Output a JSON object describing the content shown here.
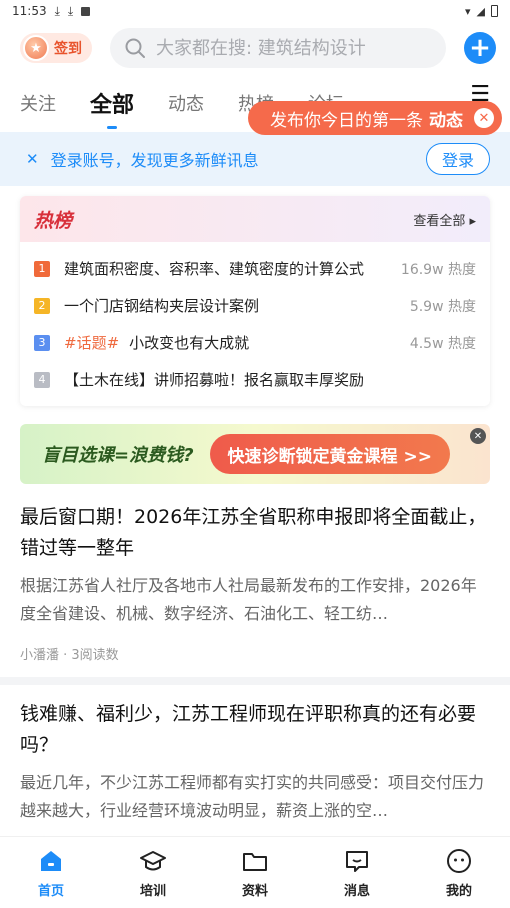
{
  "status": {
    "time": "11:53",
    "icons_left": [
      "download-icon",
      "download-icon",
      "app-icon"
    ],
    "icons_right": [
      "wifi-icon",
      "signal-icon",
      "battery-icon"
    ]
  },
  "header": {
    "checkin_label": "签到",
    "search_placeholder": "大家都在搜: 建筑结构设计"
  },
  "tabs": [
    {
      "label": "关注"
    },
    {
      "label": "全部"
    },
    {
      "label": "动态"
    },
    {
      "label": "热榜"
    },
    {
      "label": "论坛"
    }
  ],
  "bubble": {
    "text": "发布你今日的第一条",
    "emph": "动态"
  },
  "login": {
    "message": "登录账号，发现更多新鲜讯息",
    "button": "登录"
  },
  "hot": {
    "title": "热榜",
    "more": "查看全部 ▸",
    "items": [
      {
        "rank": "1",
        "text": "建筑面积密度、容积率、建筑密度的计算公式",
        "tag": "",
        "heat": "16.9w 热度",
        "color": "#f06a3a"
      },
      {
        "rank": "2",
        "text": "一个门店钢结构夹层设计案例",
        "tag": "",
        "heat": "5.9w 热度",
        "color": "#f5b526"
      },
      {
        "rank": "3",
        "text": "小改变也有大成就",
        "tag": "#话题#",
        "heat": "4.5w 热度",
        "color": "#5b8ff0"
      },
      {
        "rank": "4",
        "text": "【土木在线】讲师招募啦！报名赢取丰厚奖励",
        "tag": "",
        "heat": "",
        "color": "#b9bcc4"
      }
    ]
  },
  "banner": {
    "left": "盲目选课=浪费钱?",
    "right": "快速诊断锁定黄金课程 >>"
  },
  "articles": [
    {
      "title": "最后窗口期！2026年江苏全省职称申报即将全面截止，错过等一整年",
      "summary": "根据江苏省人社厅及各地市人社局最新发布的工作安排，2026年度全省建设、机械、数字经济、石油化工、轻工纺…",
      "meta": "小潘潘 · 3阅读数"
    },
    {
      "title": "钱难赚、福利少，江苏工程师现在评职称真的还有必要吗？",
      "summary": "最近几年，不少江苏工程师都有实打实的共同感受：项目交付压力越来越大，行业经营环境波动明显，薪资上涨的空…",
      "meta": ""
    }
  ],
  "nav": [
    {
      "label": "首页",
      "icon": "home-icon"
    },
    {
      "label": "培训",
      "icon": "graduation-cap-icon"
    },
    {
      "label": "资料",
      "icon": "folder-icon"
    },
    {
      "label": "消息",
      "icon": "message-icon"
    },
    {
      "label": "我的",
      "icon": "profile-icon"
    }
  ],
  "colors": {
    "accent": "#1d8cf8",
    "bubble": "#f56a4b"
  }
}
